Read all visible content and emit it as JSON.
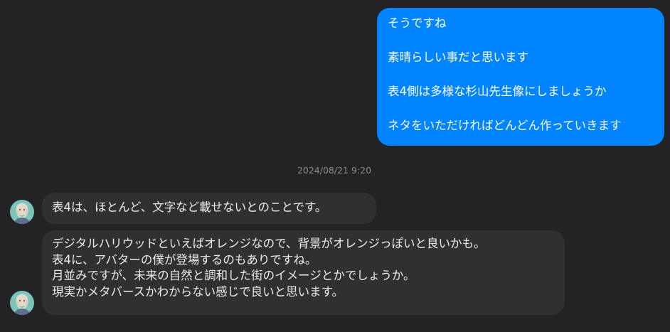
{
  "messages": {
    "outgoing": {
      "lines": [
        "そうですね",
        "素晴らしい事だと思います",
        "表4側は多様な杉山先生像にしましょうか",
        "ネタをいただければどんどん作っていきます"
      ],
      "color": "#0084ff"
    },
    "timestamp": "2024/08/21 9:20",
    "incoming": [
      {
        "lines": [
          "表4は、ほとんど、文字など載せないとのことです。"
        ]
      },
      {
        "lines": [
          "デジタルハリウッドといえばオレンジなので、背景がオレンジっぽいと良いかも。",
          "表4に、アバターの僕が登場するのもありですね。",
          "月並みですが、未来の自然と調和した街のイメージとかでしょうか。",
          "現実かメタバースかわからない感じで良いと思います。"
        ]
      }
    ],
    "incoming_bubble_color": "#303033",
    "avatar_icon": "user-avatar-icon"
  }
}
